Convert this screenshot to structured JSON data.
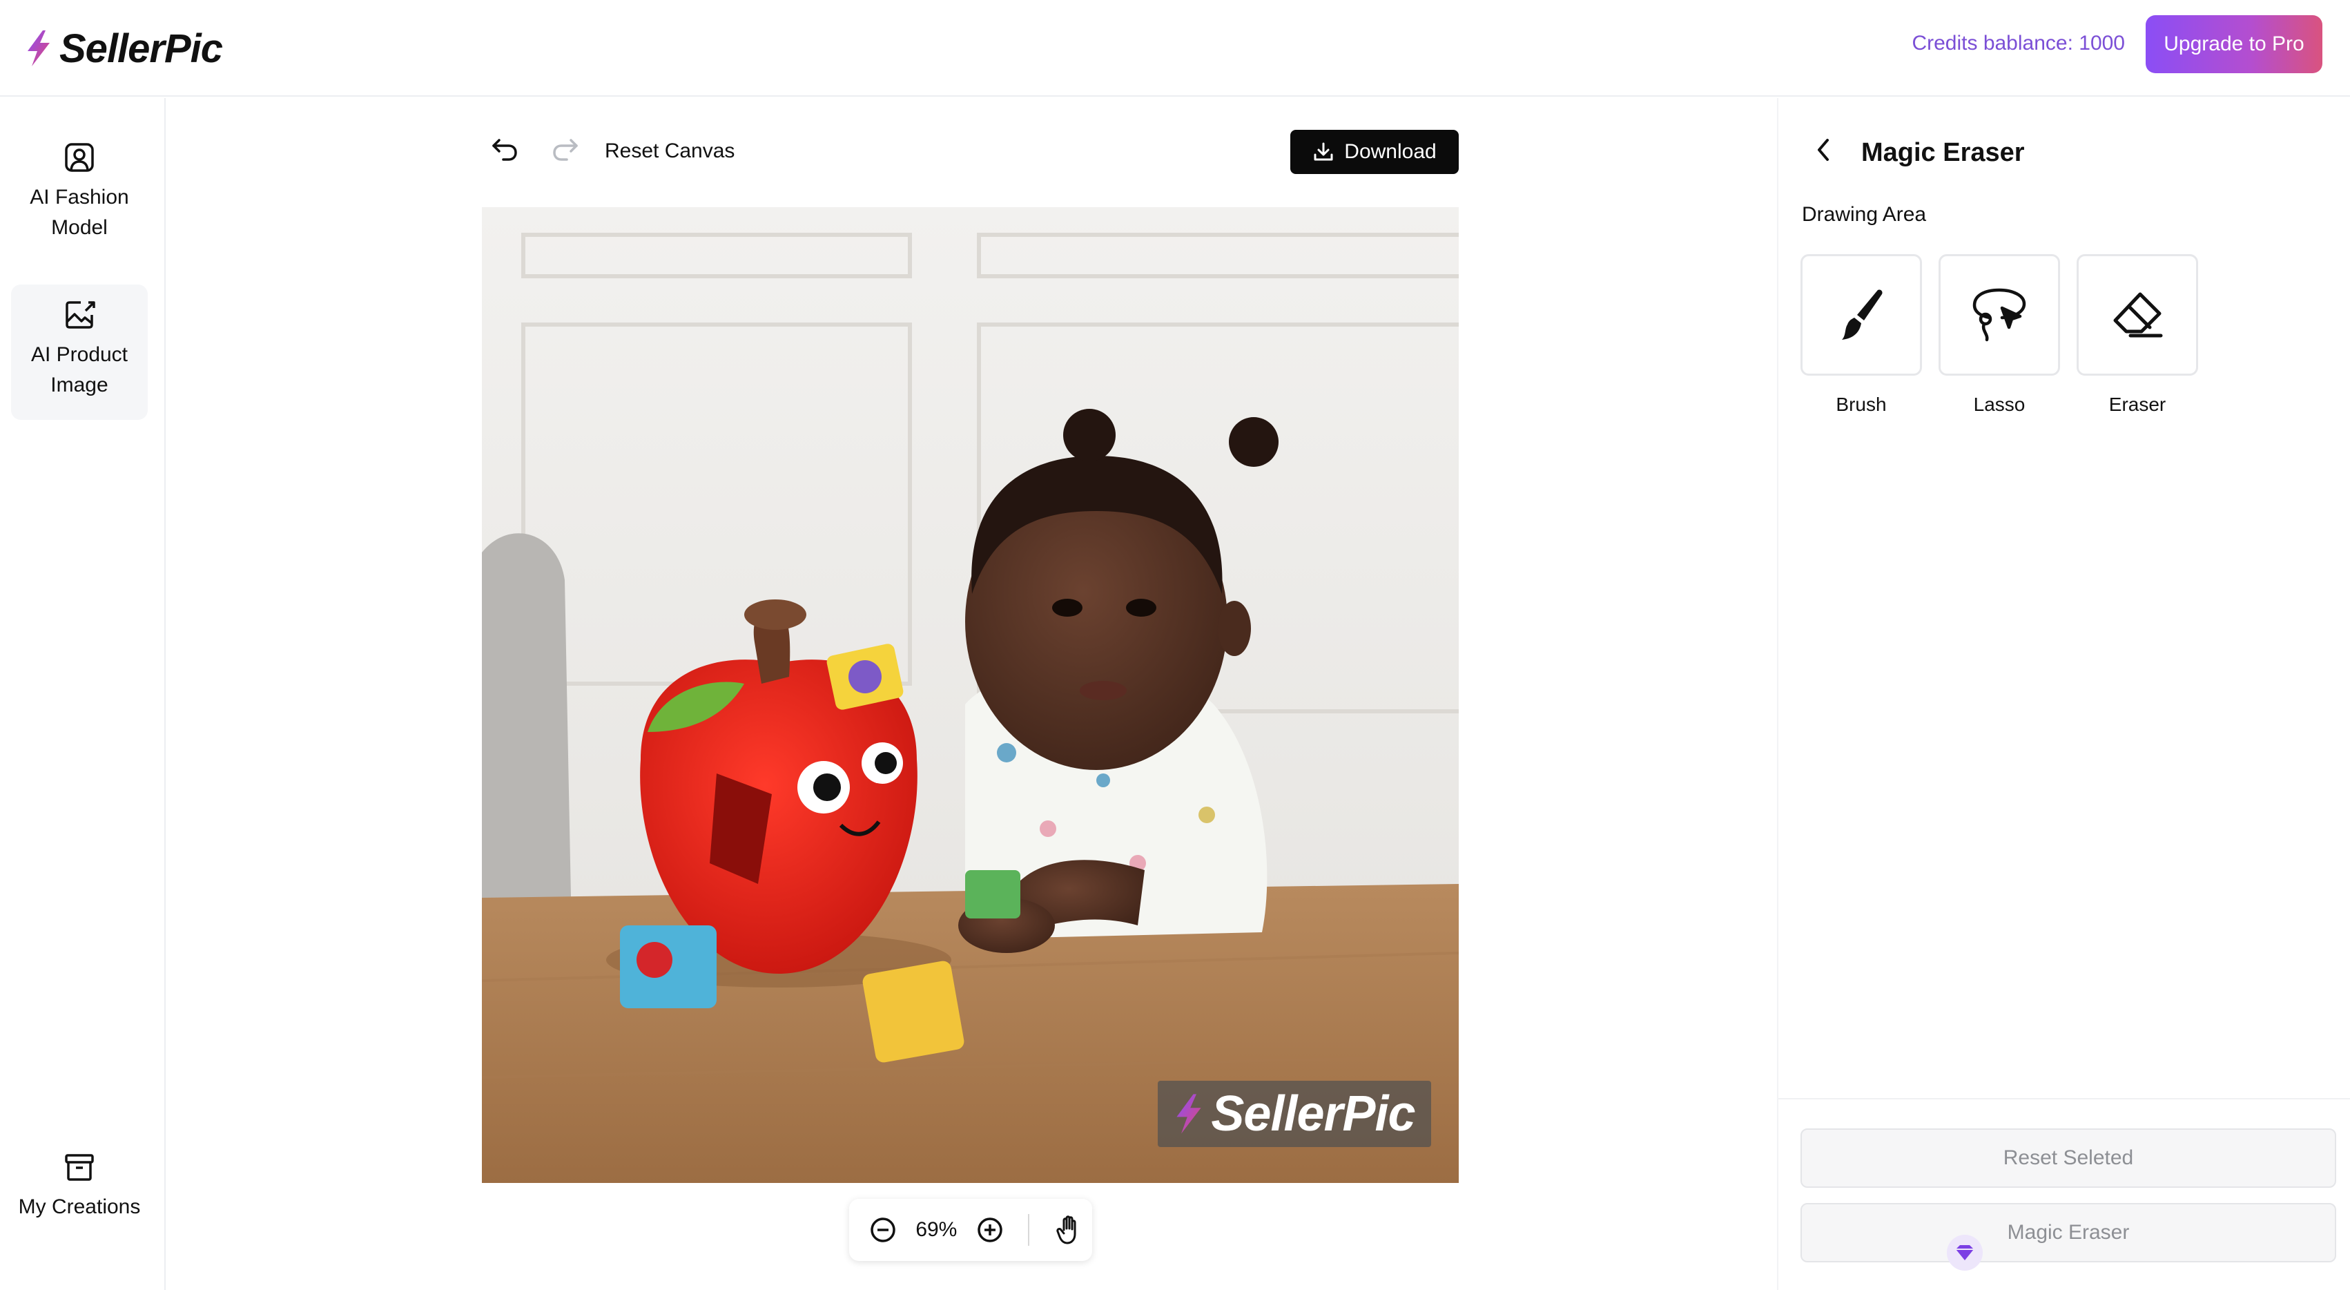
{
  "app": {
    "name": "SellerPic",
    "brand_gradient": [
      "#8b4ef5",
      "#d9537f"
    ]
  },
  "header": {
    "credits_text": "Credits bablance: 1000",
    "upgrade_label": "Upgrade to Pro"
  },
  "leftnav": {
    "items": [
      {
        "label": "AI Fashion Model",
        "icon": "user-portrait-icon",
        "active": false
      },
      {
        "label": "AI Product Image",
        "icon": "image-edit-icon",
        "active": true
      },
      {
        "label": "My Creations",
        "icon": "archive-box-icon",
        "active": false
      }
    ]
  },
  "toolbar": {
    "undo_icon": "undo-icon",
    "redo_icon": "redo-icon",
    "reset_canvas_label": "Reset Canvas",
    "download_label": "Download"
  },
  "canvas": {
    "watermark_text": "SellerPic"
  },
  "zoom": {
    "value": "69%"
  },
  "panel": {
    "title": "Magic Eraser",
    "drawing_area_label": "Drawing Area",
    "tools": [
      {
        "label": "Brush",
        "icon": "brush-icon"
      },
      {
        "label": "Lasso",
        "icon": "lasso-icon"
      },
      {
        "label": "Eraser",
        "icon": "eraser-icon"
      }
    ],
    "reset_selected_label": "Reset Seleted",
    "magic_eraser_label": "Magic Eraser"
  }
}
